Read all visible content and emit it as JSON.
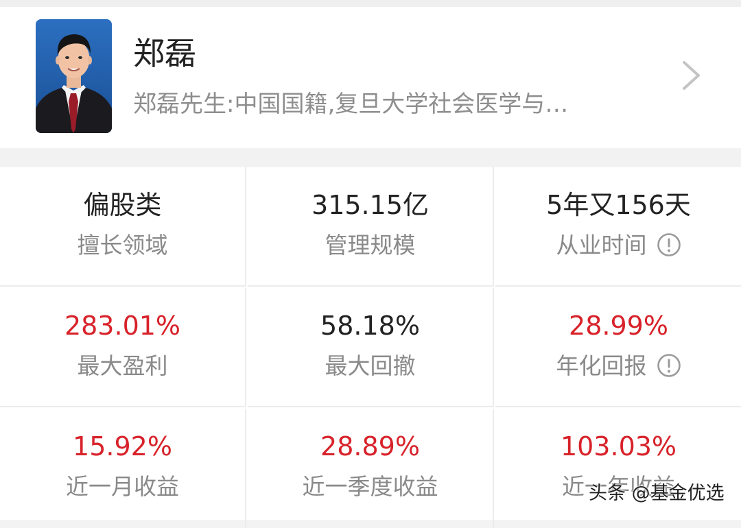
{
  "manager": {
    "name": "郑磊",
    "bio": "郑磊先生:中国国籍,复旦大学社会医学与…",
    "avatar_icon": "person-photo"
  },
  "stats": [
    {
      "value": "偏股类",
      "label": "擅长领域",
      "highlight": false,
      "info": false
    },
    {
      "value": "315.15亿",
      "label": "管理规模",
      "highlight": false,
      "info": false
    },
    {
      "value": "5年又156天",
      "label": "从业时间",
      "highlight": false,
      "info": true
    },
    {
      "value": "283.01%",
      "label": "最大盈利",
      "highlight": true,
      "info": false
    },
    {
      "value": "58.18%",
      "label": "最大回撤",
      "highlight": false,
      "info": false
    },
    {
      "value": "28.99%",
      "label": "年化回报",
      "highlight": true,
      "info": true
    },
    {
      "value": "15.92%",
      "label": "近一月收益",
      "highlight": true,
      "info": false
    },
    {
      "value": "28.89%",
      "label": "近一季度收益",
      "highlight": true,
      "info": false
    },
    {
      "value": "103.03%",
      "label": "近一年收益",
      "highlight": true,
      "info": false
    }
  ],
  "watermark": "头条 @基金优选",
  "colors": {
    "positive": "#d8222a",
    "text": "#222222",
    "muted": "#8a8a8a"
  }
}
